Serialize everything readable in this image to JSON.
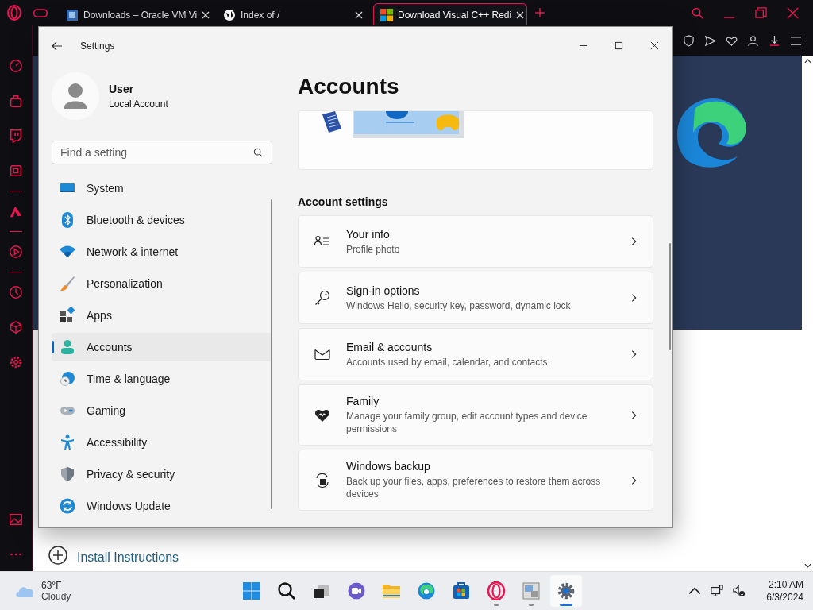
{
  "browser": {
    "tabs": [
      {
        "label": "Downloads – Oracle VM Vi",
        "kind": "vbox",
        "selected": false
      },
      {
        "label": "Index of /",
        "kind": "globe",
        "selected": false
      },
      {
        "label": "Download Visual C++ Redi",
        "kind": "windows",
        "selected": true
      }
    ],
    "page": {
      "link": "Install Instructions"
    }
  },
  "settings": {
    "title": "Settings",
    "user": {
      "name": "User",
      "account": "Local Account"
    },
    "search": {
      "placeholder": "Find a setting"
    },
    "nav": [
      {
        "label": "System",
        "kind": "system",
        "selected": false
      },
      {
        "label": "Bluetooth & devices",
        "kind": "bluetooth",
        "selected": false
      },
      {
        "label": "Network & internet",
        "kind": "network",
        "selected": false
      },
      {
        "label": "Personalization",
        "kind": "personalization",
        "selected": false
      },
      {
        "label": "Apps",
        "kind": "apps",
        "selected": false
      },
      {
        "label": "Accounts",
        "kind": "accounts",
        "selected": true
      },
      {
        "label": "Time & language",
        "kind": "time",
        "selected": false
      },
      {
        "label": "Gaming",
        "kind": "gaming",
        "selected": false
      },
      {
        "label": "Accessibility",
        "kind": "accessibility",
        "selected": false
      },
      {
        "label": "Privacy & security",
        "kind": "privacy",
        "selected": false
      },
      {
        "label": "Windows Update",
        "kind": "update",
        "selected": false
      }
    ],
    "page_title": "Accounts",
    "section": "Account settings",
    "cards": [
      {
        "title": "Your info",
        "subtitle": "Profile photo",
        "kind": "info"
      },
      {
        "title": "Sign-in options",
        "subtitle": "Windows Hello, security key, password, dynamic lock",
        "kind": "key"
      },
      {
        "title": "Email & accounts",
        "subtitle": "Accounts used by email, calendar, and contacts",
        "kind": "mail"
      },
      {
        "title": "Family",
        "subtitle": "Manage your family group, edit account types and device permissions",
        "kind": "family"
      },
      {
        "title": "Windows backup",
        "subtitle": "Back up your files, apps, preferences to restore them across devices",
        "kind": "backup"
      }
    ]
  },
  "taskbar": {
    "weather": {
      "temp": "63°F",
      "condition": "Cloudy"
    },
    "apps": [
      {
        "kind": "start",
        "running": false,
        "selected": false
      },
      {
        "kind": "search",
        "running": false,
        "selected": false
      },
      {
        "kind": "taskview",
        "running": false,
        "selected": false
      },
      {
        "kind": "meet",
        "running": false,
        "selected": false
      },
      {
        "kind": "explorer",
        "running": false,
        "selected": false
      },
      {
        "kind": "edge",
        "running": false,
        "selected": false
      },
      {
        "kind": "store",
        "running": false,
        "selected": false
      },
      {
        "kind": "opera",
        "running": true,
        "selected": false
      },
      {
        "kind": "viewer",
        "running": true,
        "selected": false
      },
      {
        "kind": "settings",
        "running": true,
        "selected": true
      }
    ],
    "clock": {
      "time": "2:10 AM",
      "date": "6/3/2024"
    }
  }
}
